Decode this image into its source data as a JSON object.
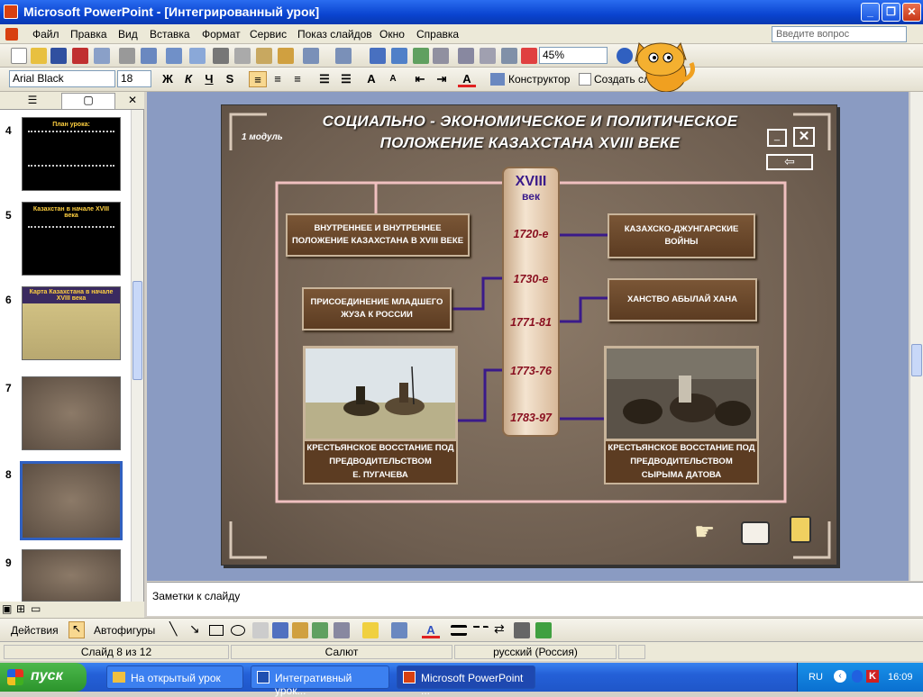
{
  "window": {
    "title": "Microsoft PowerPoint - [Интегрированный урок]"
  },
  "menu": {
    "items": [
      "Файл",
      "Правка",
      "Вид",
      "Вставка",
      "Формат",
      "Сервис",
      "Показ слайдов",
      "Окно",
      "Справка"
    ],
    "ask_placeholder": "Введите вопрос"
  },
  "standard_toolbar": {
    "zoom": "45%"
  },
  "format_toolbar": {
    "font": "Arial Black",
    "size": "18",
    "bold": "Ж",
    "italic": "К",
    "underline": "Ч",
    "shadow": "S",
    "designer": "Конструктор",
    "new_slide": "Создать слай"
  },
  "thumbnails": [
    {
      "num": "4",
      "title": "План урока:"
    },
    {
      "num": "5",
      "title": "Казахстан в начале XVIII века"
    },
    {
      "num": "6",
      "title": "Карта Казахстана в начале XVIII века"
    },
    {
      "num": "7",
      "title": ""
    },
    {
      "num": "8",
      "title": ""
    },
    {
      "num": "9",
      "title": ""
    }
  ],
  "slide": {
    "module": "1 модуль",
    "title_line1": "СОЦИАЛЬНО - ЭКОНОМИЧЕСКОЕ И ПОЛИТИЧЕСКОЕ",
    "title_line2": "ПОЛОЖЕНИЕ КАЗАХСТАНА XVIII ВЕКЕ",
    "century": "XVIII",
    "century_sub": "век",
    "years": [
      "1720-е",
      "1730-е",
      "1771-81",
      "1773-76",
      "1783-97"
    ],
    "box_internal": "ВНУТРЕННЕЕ И ВНУТРЕННЕЕ ПОЛОЖЕНИЕ КАЗАХСТАНА В XVIII ВЕКЕ",
    "box_junior": "ПРИСОЕДИНЕНИЕ МЛАДШЕГО ЖУЗА К РОССИИ",
    "box_wars": "КАЗАХСКО-ДЖУНГАРСКИЕ ВОЙНЫ",
    "box_ablai": "ХАНСТВО АБЫЛАЙ ХАНА",
    "caption_pugachev": [
      "КРЕСТЬЯНСКОЕ ВОССТАНИЕ ПОД",
      "ПРЕДВОДИТЕЛЬСТВОМ",
      "Е. ПУГАЧЕВА"
    ],
    "caption_datov": [
      "КРЕСТЬЯНСКОЕ ВОССТАНИЕ ПОД",
      "ПРЕДВОДИТЕЛЬСТВОМ",
      "СЫРЫМА ДАТОВА"
    ]
  },
  "notes": {
    "placeholder": "Заметки к слайду"
  },
  "drawbar": {
    "actions": "Действия",
    "autoshapes": "Автофигуры"
  },
  "status": {
    "slide": "Слайд 8 из 12",
    "design": "Салют",
    "lang": "русский (Россия)"
  },
  "taskbar": {
    "start": "пуск",
    "tasks": [
      "На открытый урок",
      "Интегративный урок...",
      "Microsoft PowerPoint ..."
    ],
    "lang": "RU",
    "time": "16:09"
  },
  "colors": {
    "accent": "#0a44d0",
    "slide_bg": "#6e5e50",
    "year_text": "#8a1020"
  }
}
